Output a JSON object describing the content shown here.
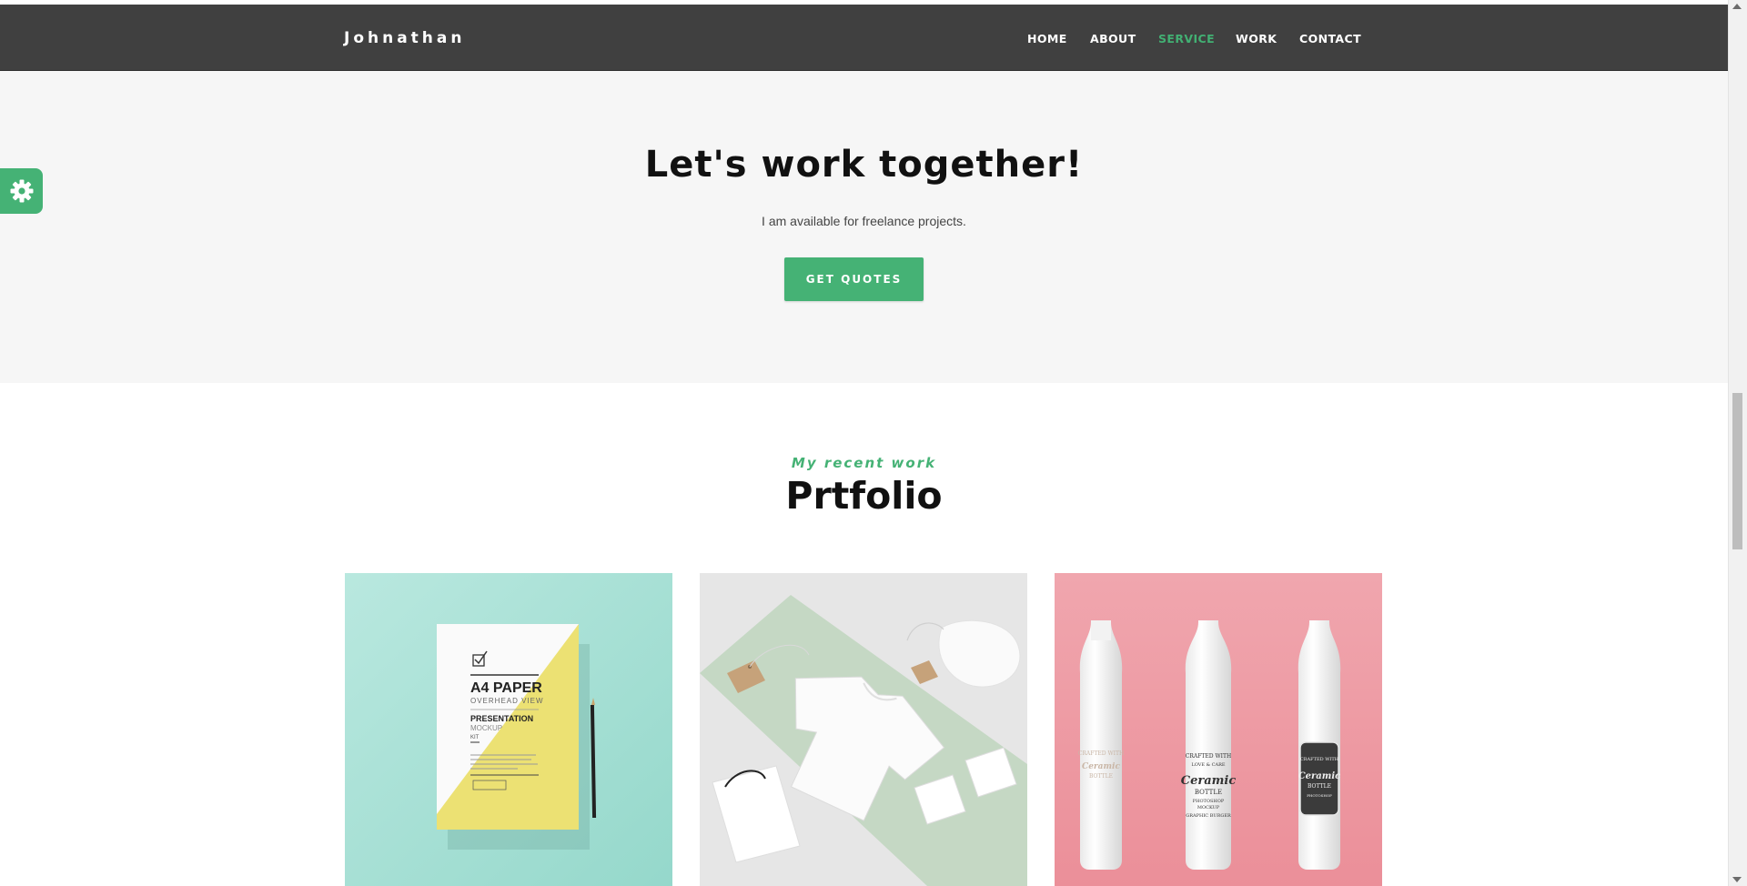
{
  "navbar": {
    "brand": "Johnathan",
    "links": [
      {
        "label": "HOME",
        "active": false
      },
      {
        "label": "ABOUT",
        "active": false
      },
      {
        "label": "SERVICE",
        "active": true
      },
      {
        "label": "WORK",
        "active": false
      },
      {
        "label": "CONTACT",
        "active": false
      }
    ]
  },
  "settings": {
    "icon": "gear-icon",
    "color": "#45b275"
  },
  "hero": {
    "title": "Let's work together!",
    "subtitle": "I am available for freelance projects.",
    "button_label": "GET QUOTES"
  },
  "portfolio": {
    "kicker": "My recent work",
    "title": "Prtfolio",
    "items": [
      {
        "image": "a4-paper-mockup",
        "paper_title": "A4 PAPER",
        "paper_subtitle": "OVERHEAD VIEW",
        "paper_heading": "PRESENTATION",
        "paper_mockup": "MOCKUP",
        "paper_kit": "KIT"
      },
      {
        "image": "t-shirt-branding-mockup"
      },
      {
        "image": "ceramic-bottle-mockup",
        "bottle_top": "CRAFTED WITH",
        "bottle_love": "LOVE & CARE",
        "bottle_name": "Ceramic",
        "bottle_sub": "BOTTLE",
        "bottle_ps": "PHOTOSHOP",
        "bottle_mockup": "MOCKUP",
        "bottle_gfx": "GRAPHIC BURGER"
      }
    ]
  },
  "colors": {
    "accent": "#45b275",
    "navbar_bg": "#404040",
    "hero_bg": "#f6f6f6"
  }
}
